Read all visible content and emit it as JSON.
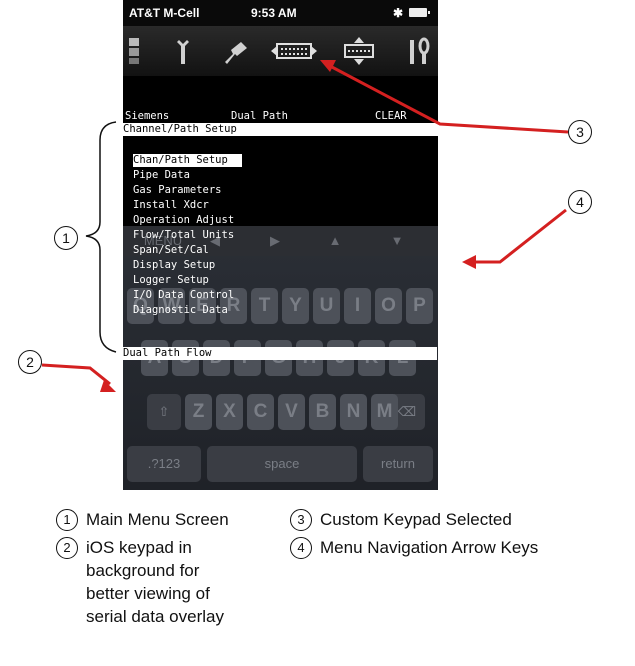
{
  "status_bar": {
    "carrier": "AT&T M-Cell",
    "time": "9:53 AM",
    "bluetooth": "✱"
  },
  "toolbar": {
    "icons": [
      "left-bar-icon",
      "wrench-icon",
      "plug-icon",
      "keypad-icon",
      "move-keypad-icon",
      "tools-icon"
    ]
  },
  "terminal": {
    "header_left": "Siemens",
    "header_mid": "Dual Path",
    "header_right": "CLEAR",
    "section_title": "Channel/Path Setup",
    "menu_items": [
      "Chan/Path Setup",
      "Pipe Data",
      "Gas Parameters",
      "Install Xdcr",
      "Operation Adjust",
      "Flow/Total Units",
      "Span/Set/Cal",
      "Display Setup",
      "Logger Setup",
      "I/O Data Control",
      "Diagnostic Data"
    ],
    "footer": "Dual Path Flow"
  },
  "keyboard": {
    "arrow_row": [
      "MENU",
      "◀",
      "▶",
      "▲",
      "▼"
    ],
    "row1": [
      "Q",
      "W",
      "E",
      "R",
      "T",
      "Y",
      "U",
      "I",
      "O",
      "P"
    ],
    "row2": [
      "A",
      "S",
      "D",
      "F",
      "G",
      "H",
      "J",
      "K",
      "L"
    ],
    "row3": [
      "Z",
      "X",
      "C",
      "V",
      "B",
      "N",
      "M"
    ],
    "bottom": {
      "numbers": ".?123",
      "space": "space",
      "return": "return"
    }
  },
  "callouts": [
    "1",
    "2",
    "3",
    "4"
  ],
  "legend": {
    "item1": {
      "num": "1",
      "text": "Main Menu Screen"
    },
    "item2": {
      "num": "2",
      "lines": [
        "iOS keypad in",
        "background for",
        "better viewing of",
        "serial data overlay"
      ]
    },
    "item3": {
      "num": "3",
      "text": "Custom Keypad Selected"
    },
    "item4": {
      "num": "4",
      "text": "Menu Navigation Arrow Keys"
    }
  },
  "colors": {
    "arrow": "#d42020",
    "screen": "#000000",
    "keyboard": "#262930"
  }
}
